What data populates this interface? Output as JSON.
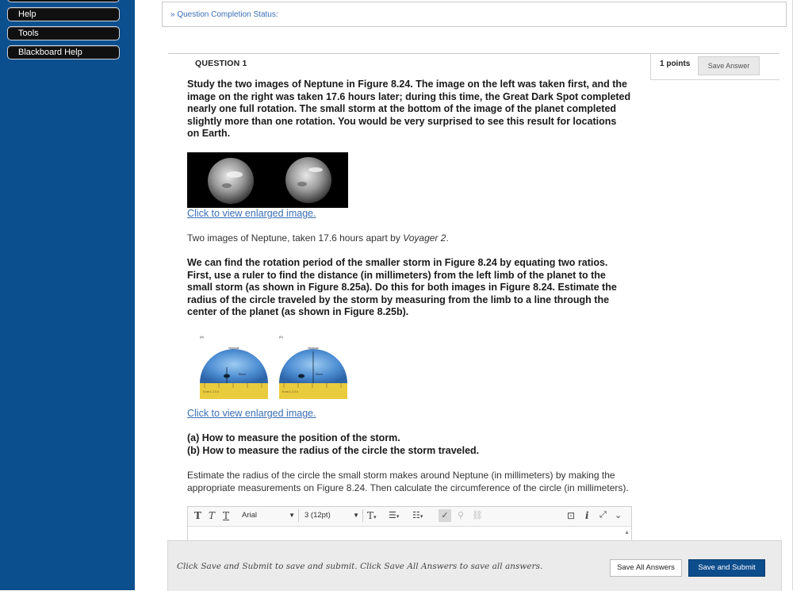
{
  "sidebar": {
    "items": [
      {
        "label": ""
      },
      {
        "label": "Help"
      },
      {
        "label": "Tools"
      },
      {
        "label": "Blackboard Help"
      }
    ]
  },
  "status": {
    "label": "» Question Completion Status:"
  },
  "question": {
    "title": "QUESTION 1",
    "points": "1 points",
    "save_label": "Save Answer",
    "intro": "Study the two images of Neptune in Figure 8.24. The image on the left was taken first, and the image on the right was taken 17.6 hours later; during this time, the Great Dark Spot completed nearly one full rotation. The small storm at the bottom of the image of the planet completed slightly more than one rotation. You would be very surprised to see this result for locations on Earth.",
    "enlarge_link_1": "Click to view enlarged image.",
    "caption_1_prefix": "Two images of Neptune, taken 17.6 hours apart by ",
    "caption_1_italic": "Voyager 2",
    "caption_1_suffix": ".",
    "instructions": "We can find the rotation period of the smaller storm in Figure 8.24 by equating two ratios. First, use a ruler to find the distance (in millimeters) from the left limb of the planet to the small storm (as shown in Figure 8.25a). Do this for both images in Figure 8.24. Estimate the radius of the circle traveled by the storm by measuring from the limb to a line through the center of the planet (as shown in Figure 8.25b).",
    "figure_2": {
      "panel_a": "(a)",
      "panel_b": "(b)",
      "planet": "Neptune",
      "storm": "Storm",
      "ruler_a": "0 cm  1     2     3     4",
      "ruler_b": "0 cm  1     2     3     4"
    },
    "enlarge_link_2": "Click to view enlarged image.",
    "caption_2a": "(a) How to measure the position of the storm.",
    "caption_2b": "(b) How to measure the radius of the circle the storm traveled.",
    "task": "Estimate the radius of the circle the small storm makes around Neptune (in millimeters) by making the appropriate measurements on Figure 8.24. Then calculate the circumference of the circle (in millimeters)."
  },
  "editor": {
    "font": "Arial",
    "size": "3 (12pt)"
  },
  "footer": {
    "hint": "Click Save and Submit to save and submit. Click Save All Answers to save all answers.",
    "save_all": "Save All Answers",
    "save_submit": "Save and Submit"
  }
}
